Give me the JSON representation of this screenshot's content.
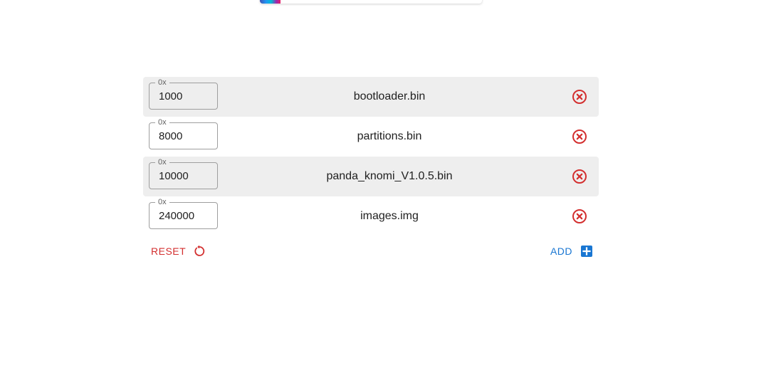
{
  "files": [
    {
      "offset_prefix": "0x",
      "offset": "1000",
      "name": "bootloader.bin"
    },
    {
      "offset_prefix": "0x",
      "offset": "8000",
      "name": "partitions.bin"
    },
    {
      "offset_prefix": "0x",
      "offset": "10000",
      "name": "panda_knomi_V1.0.5.bin"
    },
    {
      "offset_prefix": "0x",
      "offset": "240000",
      "name": "images.img"
    }
  ],
  "actions": {
    "reset_label": "RESET",
    "add_label": "ADD"
  },
  "icons": {
    "remove": "close-circle-icon",
    "reset": "refresh-icon",
    "add": "plus-box-icon"
  },
  "colors": {
    "danger": "#d32f2f",
    "primary": "#1976d2",
    "row_shade": "#eeeeee"
  }
}
